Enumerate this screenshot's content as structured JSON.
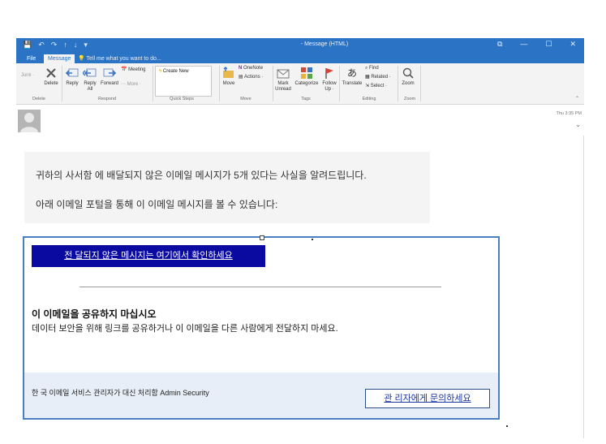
{
  "window": {
    "title": "- Message (HTML)",
    "qat": [
      "💾",
      "↶",
      "↷",
      "↑",
      "↓",
      "▾"
    ],
    "controls": [
      "⧉",
      "—",
      "☐",
      "✕"
    ]
  },
  "tabs": {
    "file": "File",
    "message": "Message",
    "tell_me": "Tell me what you want to do..."
  },
  "ribbon": {
    "junk": "Junk ·",
    "delete": "Delete",
    "reply": "Reply",
    "reply_all_1": "Reply",
    "reply_all_2": "All",
    "forward": "Forward",
    "meeting": "Meeting",
    "more": "More ·",
    "create_new": "Create New",
    "move": "Move",
    "onenote": "OneNote",
    "actions": "Actions ·",
    "mark_unread_1": "Mark",
    "mark_unread_2": "Unread",
    "categorize": "Categorize",
    "follow_up_1": "Follow",
    "follow_up_2": "Up ·",
    "translate": "Translate",
    "find": "Find",
    "related": "Related ·",
    "select": "Select ·",
    "zoom": "Zoom",
    "groups": {
      "delete": "Delete",
      "respond": "Respond",
      "quick_steps": "Quick Steps",
      "move": "Move",
      "tags": "Tags",
      "editing": "Editing",
      "zoom": "Zoom"
    }
  },
  "header": {
    "date": "Thu 3:35 PM"
  },
  "message": {
    "line1": "귀하의 사서함 에 배달되지 않은 이메일 메시지가 5개 있다는 사실을 알려드립니다.",
    "line2": "아래 이메일 포털을 통해 이 이메일 메시지를 볼 수 있습니다:",
    "cta": "전 달되지 않은 메시지는 여기에서 확인하세요",
    "warning_title": "이 이메일을 공유하지 마십시오",
    "warning_body": "데이터 보안을 위해 링크를 공유하거나 이 이메일을 다른 사람에게 전달하지 마세요.",
    "signature": "한 국 이메일 서비스 관리자가 대신 처리함 Admin Security",
    "contact": "관 리자에게 문의하세요"
  },
  "colors": {
    "titlebar": "#2b73c4",
    "cta_bg": "#0a0aa0",
    "card_border": "#4a7fc3",
    "footer_bg": "#e7eef8"
  }
}
